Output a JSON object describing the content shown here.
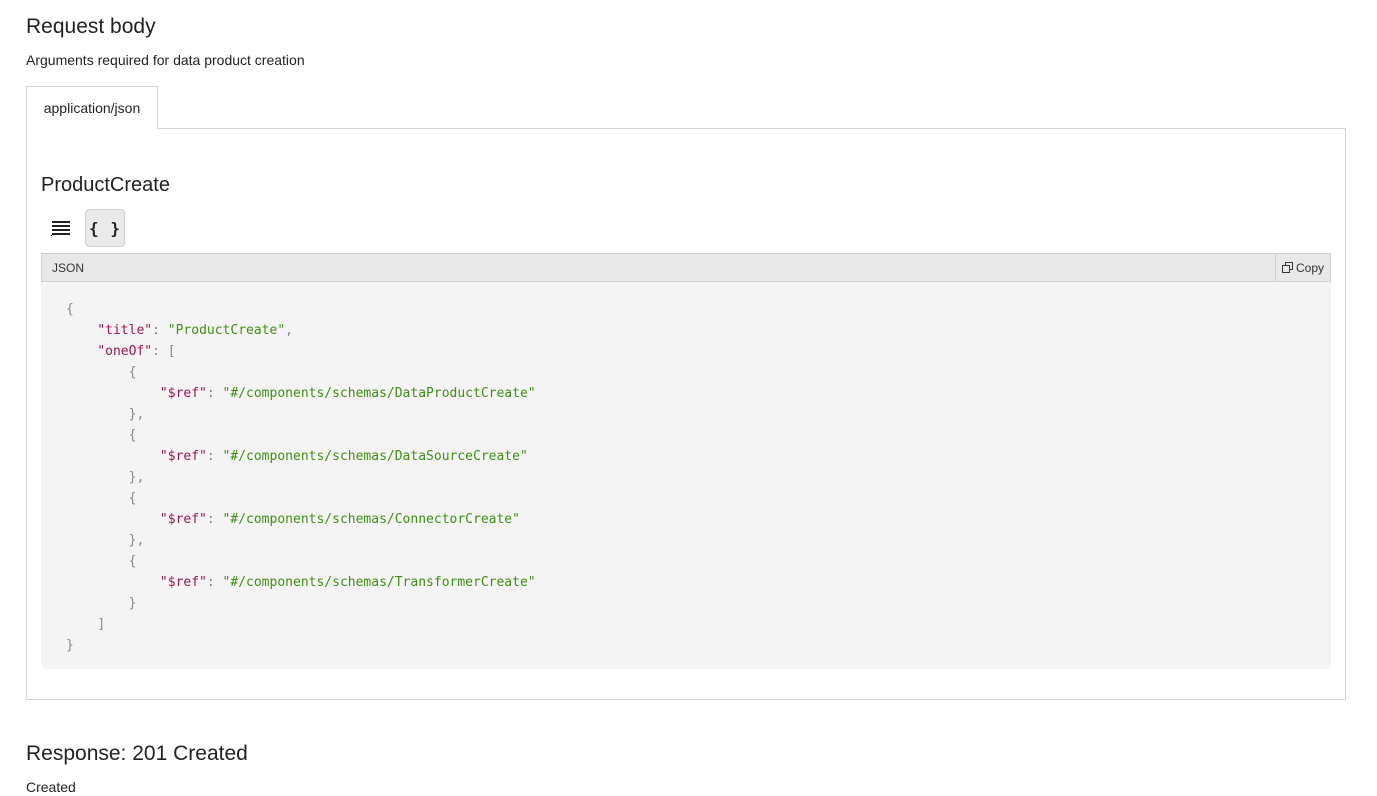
{
  "request_body": {
    "title": "Request body",
    "description": "Arguments required for data product creation",
    "tabs": [
      {
        "label": "application/json",
        "active": true
      }
    ]
  },
  "schema": {
    "title": "ProductCreate",
    "view_modes": {
      "list_icon": "list-view-icon",
      "json_label": "{ }",
      "active": "json"
    },
    "code_block": {
      "language": "JSON",
      "copy_label": "Copy",
      "copy_icon": "copy-icon",
      "lines": [
        {
          "indent": 0,
          "tokens": [
            {
              "t": "punc",
              "v": "{"
            }
          ]
        },
        {
          "indent": 1,
          "tokens": [
            {
              "t": "key",
              "v": "\"title\""
            },
            {
              "t": "punc",
              "v": ": "
            },
            {
              "t": "str",
              "v": "\"ProductCreate\""
            },
            {
              "t": "punc",
              "v": ","
            }
          ]
        },
        {
          "indent": 1,
          "tokens": [
            {
              "t": "key",
              "v": "\"oneOf\""
            },
            {
              "t": "punc",
              "v": ": ["
            }
          ]
        },
        {
          "indent": 2,
          "tokens": [
            {
              "t": "punc",
              "v": "{"
            }
          ]
        },
        {
          "indent": 3,
          "tokens": [
            {
              "t": "key",
              "v": "\"$ref\""
            },
            {
              "t": "punc",
              "v": ": "
            },
            {
              "t": "str",
              "v": "\"#/components/schemas/DataProductCreate\""
            }
          ]
        },
        {
          "indent": 2,
          "tokens": [
            {
              "t": "punc",
              "v": "},"
            }
          ]
        },
        {
          "indent": 2,
          "tokens": [
            {
              "t": "punc",
              "v": "{"
            }
          ]
        },
        {
          "indent": 3,
          "tokens": [
            {
              "t": "key",
              "v": "\"$ref\""
            },
            {
              "t": "punc",
              "v": ": "
            },
            {
              "t": "str",
              "v": "\"#/components/schemas/DataSourceCreate\""
            }
          ]
        },
        {
          "indent": 2,
          "tokens": [
            {
              "t": "punc",
              "v": "},"
            }
          ]
        },
        {
          "indent": 2,
          "tokens": [
            {
              "t": "punc",
              "v": "{"
            }
          ]
        },
        {
          "indent": 3,
          "tokens": [
            {
              "t": "key",
              "v": "\"$ref\""
            },
            {
              "t": "punc",
              "v": ": "
            },
            {
              "t": "str",
              "v": "\"#/components/schemas/ConnectorCreate\""
            }
          ]
        },
        {
          "indent": 2,
          "tokens": [
            {
              "t": "punc",
              "v": "},"
            }
          ]
        },
        {
          "indent": 2,
          "tokens": [
            {
              "t": "punc",
              "v": "{"
            }
          ]
        },
        {
          "indent": 3,
          "tokens": [
            {
              "t": "key",
              "v": "\"$ref\""
            },
            {
              "t": "punc",
              "v": ": "
            },
            {
              "t": "str",
              "v": "\"#/components/schemas/TransformerCreate\""
            }
          ]
        },
        {
          "indent": 2,
          "tokens": [
            {
              "t": "punc",
              "v": "}"
            }
          ]
        },
        {
          "indent": 1,
          "tokens": [
            {
              "t": "punc",
              "v": "]"
            }
          ]
        },
        {
          "indent": 0,
          "tokens": [
            {
              "t": "punc",
              "v": "}"
            }
          ]
        }
      ]
    }
  },
  "response": {
    "title": "Response: 201 Created",
    "description": "Created"
  },
  "colors": {
    "json_key": "#a11355",
    "json_string": "#3f8f14",
    "json_punctuation": "#888888",
    "code_background": "#f4f4f4",
    "code_header_background": "#e8e8e8"
  }
}
